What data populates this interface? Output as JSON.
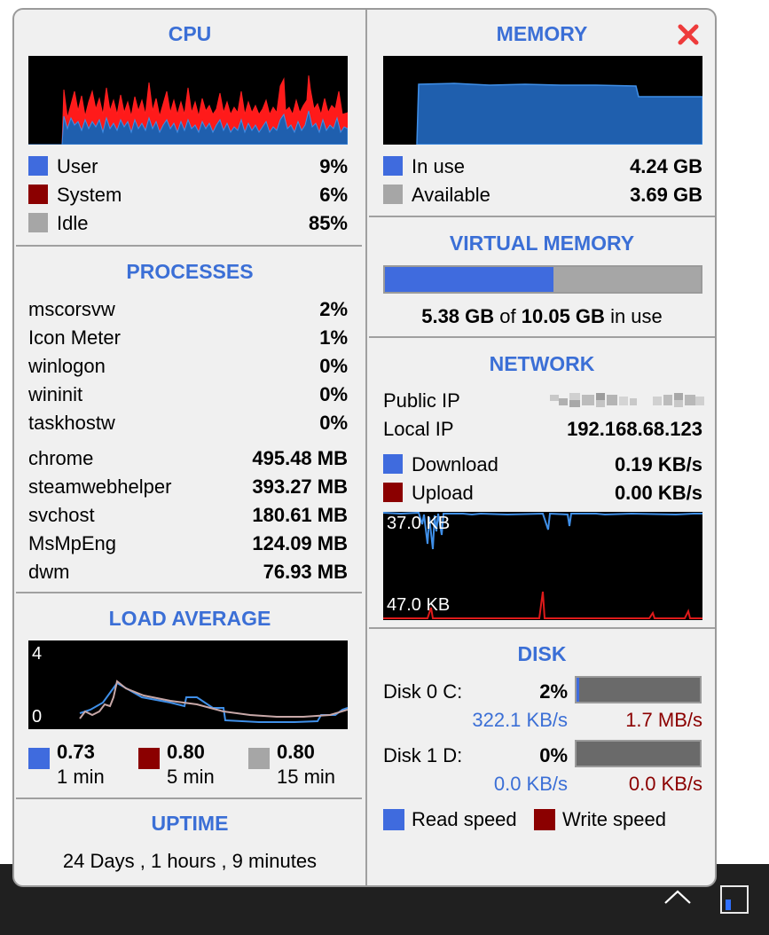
{
  "cpu": {
    "title": "CPU",
    "legend": [
      {
        "label": "User",
        "value": "9%",
        "color": "#3f6bde"
      },
      {
        "label": "System",
        "value": "6%",
        "color": "#8b0000"
      },
      {
        "label": "Idle",
        "value": "85%",
        "color": "#a6a6a6"
      }
    ]
  },
  "memory": {
    "title": "MEMORY",
    "legend": [
      {
        "label": "In use",
        "value": "4.24 GB",
        "color": "#3f6bde"
      },
      {
        "label": "Available",
        "value": "3.69 GB",
        "color": "#a6a6a6"
      }
    ]
  },
  "virtual_memory": {
    "title": "VIRTUAL MEMORY",
    "used": "5.38 GB",
    "of_text": "of",
    "total": "10.05 GB",
    "suffix": "in use",
    "fill_fraction": 0.535
  },
  "processes": {
    "title": "PROCESSES",
    "cpu_list": [
      {
        "name": "mscorsvw",
        "value": "2%"
      },
      {
        "name": "Icon Meter",
        "value": "1%"
      },
      {
        "name": "winlogon",
        "value": "0%"
      },
      {
        "name": "wininit",
        "value": "0%"
      },
      {
        "name": "taskhostw",
        "value": "0%"
      }
    ],
    "mem_list": [
      {
        "name": "chrome",
        "value": "495.48 MB"
      },
      {
        "name": "steamwebhelper",
        "value": "393.27 MB"
      },
      {
        "name": "svchost",
        "value": "180.61 MB"
      },
      {
        "name": "MsMpEng",
        "value": "124.09 MB"
      },
      {
        "name": "dwm",
        "value": "76.93 MB"
      }
    ]
  },
  "network": {
    "title": "NETWORK",
    "public_ip_label": "Public IP",
    "local_ip_label": "Local IP",
    "local_ip": "192.168.68.123",
    "download_label": "Download",
    "download_value": "0.19 KB/s",
    "upload_label": "Upload",
    "upload_value": "0.00 KB/s",
    "graph_top_label": "37.0 KB",
    "graph_bottom_label": "47.0 KB"
  },
  "load": {
    "title": "LOAD AVERAGE",
    "graph_max": "4",
    "graph_min": "0",
    "items": [
      {
        "value": "0.73",
        "period": "1 min",
        "color": "#3f6bde"
      },
      {
        "value": "0.80",
        "period": "5 min",
        "color": "#8b0000"
      },
      {
        "value": "0.80",
        "period": "15 min",
        "color": "#a6a6a6"
      }
    ]
  },
  "disk": {
    "title": "DISK",
    "disks": [
      {
        "label": "Disk 0 C:",
        "percent": "2%",
        "fill_fraction": 0.02,
        "read": "322.1 KB/s",
        "write": "1.7 MB/s"
      },
      {
        "label": "Disk 1 D:",
        "percent": "0%",
        "fill_fraction": 0.0,
        "read": "0.0 KB/s",
        "write": "0.0 KB/s"
      }
    ],
    "read_legend": "Read speed",
    "write_legend": "Write speed"
  },
  "uptime": {
    "title": "UPTIME",
    "value": "24 Days , 1 hours , 9 minutes"
  }
}
